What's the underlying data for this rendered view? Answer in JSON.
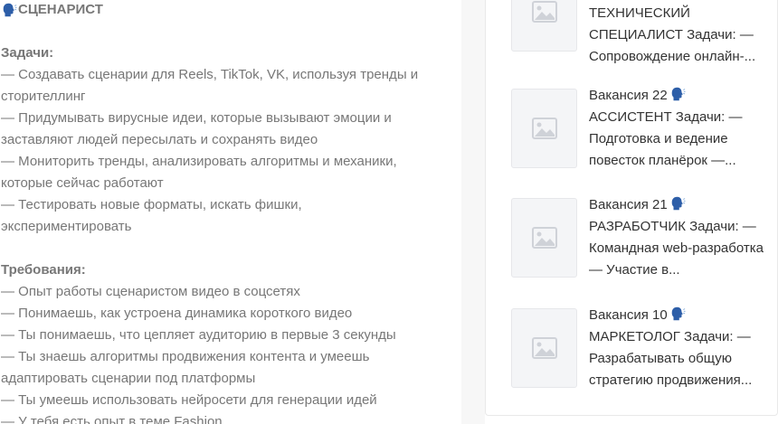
{
  "vacancy": {
    "title": "СЦЕНАРИСТ",
    "tasks_heading": "Задачи:",
    "task_lines": [
      "— Создавать сценарии для Reels, TikTok, VK, используя тренды и",
      "сторителлинг",
      "— Придумывать вирусные идеи, которые вызывают эмоции и",
      "заставляют людей пересылать и сохранять видео",
      "— Мониторить тренды, анализировать алгоритмы и механики,",
      "которые сейчас работают",
      "— Тестировать новые форматы, искать фишки,",
      "экспериментировать"
    ],
    "requirements_heading": "Требования:",
    "requirement_lines": [
      "— Опыт работы сценаристом видео в соцсетях",
      "— Понимаешь, как устроена динамика короткого видео",
      "— Ты понимаешь, что цепляет аудиторию в первые 3 секунды",
      "— Ты знаешь алгоритмы продвижения контента и умеешь",
      "адаптировать сценарии под платформы",
      "— Ты умеешь использовать нейросети для генерации идей",
      "— У тебя есть опыт в теме Fashion"
    ]
  },
  "related": [
    {
      "lines": [
        "ТЕХНИЧЕСКИЙ",
        "СПЕЦИАЛИСТ Задачи: —",
        "Сопровождение онлайн-..."
      ]
    },
    {
      "first": "Вакансия 22",
      "lines": [
        "АССИСТЕНТ Задачи: —",
        "Подготовка и ведение",
        "повесток планёрок —..."
      ]
    },
    {
      "first": "Вакансия 21",
      "lines": [
        "РАЗРАБОТЧИК Задачи: —",
        "Командная web-разработка",
        "— Участие в..."
      ]
    },
    {
      "first": "Вакансия 10",
      "lines": [
        "МАРКЕТОЛОГ Задачи: —",
        "Разрабатывать общую",
        "стратегию продвижения..."
      ]
    }
  ],
  "icons": {
    "speaking": "speaking-head-icon",
    "placeholder": "image-placeholder-icon"
  },
  "colors": {
    "body_text": "#777777",
    "card_text": "#333333",
    "accent_blue": "#2d5ea8"
  }
}
